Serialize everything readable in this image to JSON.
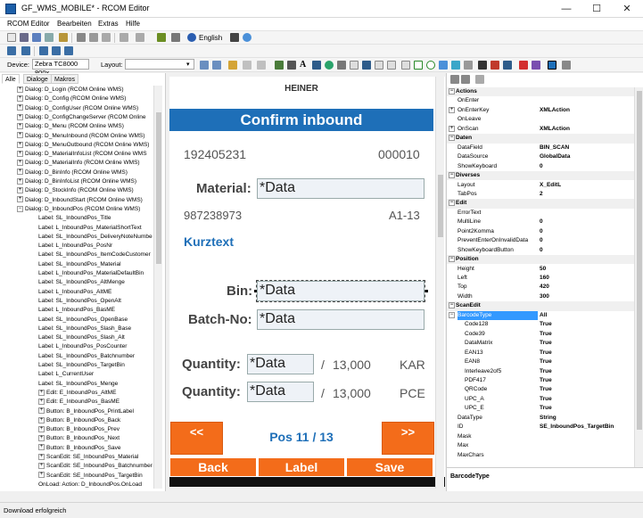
{
  "window": {
    "title": "GF_WMS_MOBILE* - RCOM Editor",
    "minimize": "—",
    "maximize": "☐",
    "close": "✕"
  },
  "menu": [
    "RCOM Editor",
    "Bearbeiten",
    "Extras",
    "Hilfe"
  ],
  "toolbar": {
    "language": "English"
  },
  "toolbar3": {
    "device_label": "Device:",
    "device_value": "Zebra TC8000 800x",
    "layout_label": "Layout:",
    "layout_value": ""
  },
  "tabs": [
    "Alle",
    "Dialoge",
    "Makros"
  ],
  "tree": [
    {
      "label": "Dialog: D_Login (RCOM Online WMS)",
      "indent": 1,
      "exp": "+"
    },
    {
      "label": "Dialog: D_Config (RCOM Online WMS)",
      "indent": 1,
      "exp": "+"
    },
    {
      "label": "Dialog: D_ConfigUser (RCOM Online WMS)",
      "indent": 1,
      "exp": "+"
    },
    {
      "label": "Dialog: D_ConfigChangeServer (RCOM Online",
      "indent": 1,
      "exp": "+"
    },
    {
      "label": "Dialog: D_Menu (RCOM Online WMS)",
      "indent": 1,
      "exp": "+"
    },
    {
      "label": "Dialog: D_MenuInbound (RCOM Online WMS)",
      "indent": 1,
      "exp": "+"
    },
    {
      "label": "Dialog: D_MenuOutbound (RCOM Online WMS)",
      "indent": 1,
      "exp": "+"
    },
    {
      "label": "Dialog: D_MaterialInfoList (RCOM Online WMS",
      "indent": 1,
      "exp": "+"
    },
    {
      "label": "Dialog: D_MaterialInfo (RCOM Online WMS)",
      "indent": 1,
      "exp": "+"
    },
    {
      "label": "Dialog: D_BinInfo (RCOM Online WMS)",
      "indent": 1,
      "exp": "+"
    },
    {
      "label": "Dialog: D_BinInfoList (RCOM Online WMS)",
      "indent": 1,
      "exp": "+"
    },
    {
      "label": "Dialog: D_StockInfo (RCOM Online WMS)",
      "indent": 1,
      "exp": "+"
    },
    {
      "label": "Dialog: D_InboundStart (RCOM Online WMS)",
      "indent": 1,
      "exp": "+"
    },
    {
      "label": "Dialog: D_InboundPos (RCOM Online WMS)",
      "indent": 1,
      "exp": "−"
    },
    {
      "label": "Label: SL_InboundPos_Title",
      "indent": 2,
      "exp": ""
    },
    {
      "label": "Label: L_InboundPos_MaterialShortText",
      "indent": 2,
      "exp": ""
    },
    {
      "label": "Label: SL_InboundPos_DeliveryNoteNumber",
      "indent": 2,
      "exp": ""
    },
    {
      "label": "Label: L_InboundPos_PosNr",
      "indent": 2,
      "exp": ""
    },
    {
      "label": "Label: SL_InboundPos_ItemCodeCustomer",
      "indent": 2,
      "exp": ""
    },
    {
      "label": "Label: SL_InboundPos_Material",
      "indent": 2,
      "exp": ""
    },
    {
      "label": "Label: L_InboundPos_MaterialDefaultBin",
      "indent": 2,
      "exp": ""
    },
    {
      "label": "Label: SL_InboundPos_AltMenge",
      "indent": 2,
      "exp": ""
    },
    {
      "label": "Label: L_InboundPos_AltME",
      "indent": 2,
      "exp": ""
    },
    {
      "label": "Label: SL_InboundPos_OpenAlt",
      "indent": 2,
      "exp": ""
    },
    {
      "label": "Label: L_InboundPos_BasME",
      "indent": 2,
      "exp": ""
    },
    {
      "label": "Label: SL_InboundPos_OpenBase",
      "indent": 2,
      "exp": ""
    },
    {
      "label": "Label: SL_InboundPos_Slash_Base",
      "indent": 2,
      "exp": ""
    },
    {
      "label": "Label: SL_InboundPos_Slash_Alt",
      "indent": 2,
      "exp": ""
    },
    {
      "label": "Label: L_InboundPos_PosCounter",
      "indent": 2,
      "exp": ""
    },
    {
      "label": "Label: SL_InboundPos_Batchnumber",
      "indent": 2,
      "exp": ""
    },
    {
      "label": "Label: SL_InboundPos_TargetBin",
      "indent": 2,
      "exp": ""
    },
    {
      "label": "Label: L_CurrentUser",
      "indent": 2,
      "exp": ""
    },
    {
      "label": "Label: SL_InboundPos_Menge",
      "indent": 2,
      "exp": ""
    },
    {
      "label": "Edit: E_InboundPos_AltME",
      "indent": 2,
      "exp": "+"
    },
    {
      "label": "Edit: E_InboundPos_BasME",
      "indent": 2,
      "exp": "+"
    },
    {
      "label": "Button: B_InboundPos_PrintLabel",
      "indent": 2,
      "exp": "+"
    },
    {
      "label": "Button: B_InboundPos_Back",
      "indent": 2,
      "exp": "+"
    },
    {
      "label": "Button: B_InboundPos_Prev",
      "indent": 2,
      "exp": "+"
    },
    {
      "label": "Button: B_InboundPos_Next",
      "indent": 2,
      "exp": "+"
    },
    {
      "label": "Button: B_InboundPos_Save",
      "indent": 2,
      "exp": "+"
    },
    {
      "label": "ScanEdit: SE_InboundPos_Material",
      "indent": 2,
      "exp": "+"
    },
    {
      "label": "ScanEdit: SE_InboundPos_Batchnumber",
      "indent": 2,
      "exp": "+"
    },
    {
      "label": "ScanEdit: SE_InboundPos_TargetBin",
      "indent": 2,
      "exp": "+"
    },
    {
      "label": "OnLoad: Action: D_InboundPos.OnLoad",
      "indent": 2,
      "exp": ""
    }
  ],
  "mobile": {
    "user": "HEINER",
    "title": "Confirm inbound",
    "delivery_note": "192405231",
    "pos_nr": "000010",
    "material_label": "Material:",
    "material_value": "*Data",
    "customer_code": "987238973",
    "default_bin": "A1-13",
    "short_text": "Kurztext",
    "bin_label": "Bin:",
    "bin_value": "*Data",
    "batch_label": "Batch-No:",
    "batch_value": "*Data",
    "qty1_label": "Quantity:",
    "qty1_value": "*Data",
    "qty1_slash": "/",
    "qty1_open": "13,000",
    "qty1_unit": "KAR",
    "qty2_label": "Quantity:",
    "qty2_value": "*Data",
    "qty2_slash": "/",
    "qty2_open": "13,000",
    "qty2_unit": "PCE",
    "prev_label": "<<",
    "next_label": ">>",
    "pos_counter": "Pos 11 / 13",
    "back_label": "Back",
    "label_label": "Label",
    "save_label": "Save"
  },
  "properties": [
    {
      "name": "Actions",
      "value": "",
      "cat": true
    },
    {
      "name": "OnEnter",
      "value": ""
    },
    {
      "name": "OnEnterKey",
      "value": "XMLAction",
      "exp": "+"
    },
    {
      "name": "OnLeave",
      "value": ""
    },
    {
      "name": "OnScan",
      "value": "XMLAction",
      "exp": "+"
    },
    {
      "name": "Daten",
      "value": "",
      "cat": true
    },
    {
      "name": "DataField",
      "value": "BIN_SCAN"
    },
    {
      "name": "DataSource",
      "value": "GlobalData"
    },
    {
      "name": "ShowKeyboard",
      "value": "0"
    },
    {
      "name": "Diverses",
      "value": "",
      "cat": true
    },
    {
      "name": "Layout",
      "value": "X_EditL"
    },
    {
      "name": "TabPos",
      "value": "2"
    },
    {
      "name": "Edit",
      "value": "",
      "cat": true
    },
    {
      "name": "ErrorText",
      "value": ""
    },
    {
      "name": "MultiLine",
      "value": "0"
    },
    {
      "name": "Point2Komma",
      "value": "0"
    },
    {
      "name": "PreventEnterOnInvalidData",
      "value": "0"
    },
    {
      "name": "ShowKeyboardButton",
      "value": "0"
    },
    {
      "name": "Position",
      "value": "",
      "cat": true
    },
    {
      "name": "Height",
      "value": "50"
    },
    {
      "name": "Left",
      "value": "160"
    },
    {
      "name": "Top",
      "value": "420"
    },
    {
      "name": "Width",
      "value": "300"
    },
    {
      "name": "ScanEdit",
      "value": "",
      "cat": true
    },
    {
      "name": "BarcodeType",
      "value": "All",
      "exp": "−",
      "selected": true
    },
    {
      "name": "Code128",
      "value": "True",
      "sub": true
    },
    {
      "name": "Code39",
      "value": "True",
      "sub": true
    },
    {
      "name": "DataMatrix",
      "value": "True",
      "sub": true
    },
    {
      "name": "EAN13",
      "value": "True",
      "sub": true
    },
    {
      "name": "EAN8",
      "value": "True",
      "sub": true
    },
    {
      "name": "Interleave2of5",
      "value": "True",
      "sub": true
    },
    {
      "name": "PDF417",
      "value": "True",
      "sub": true
    },
    {
      "name": "QRCode",
      "value": "True",
      "sub": true
    },
    {
      "name": "UPC_A",
      "value": "True",
      "sub": true
    },
    {
      "name": "UPC_E",
      "value": "True",
      "sub": true
    },
    {
      "name": "DataType",
      "value": "String"
    },
    {
      "name": "ID",
      "value": "SE_InboundPos_TargetBin"
    },
    {
      "name": "Mask",
      "value": ""
    },
    {
      "name": "Max",
      "value": ""
    },
    {
      "name": "MaxChars",
      "value": ""
    }
  ],
  "property_description": "BarcodeType",
  "status": "Download erfolgreich"
}
